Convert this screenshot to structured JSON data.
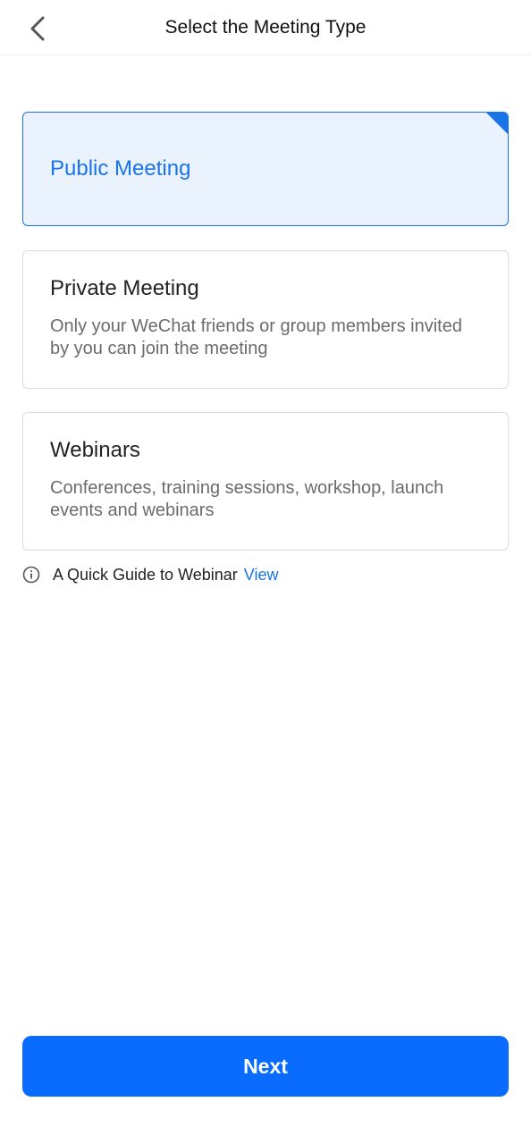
{
  "header": {
    "title": "Select the Meeting Type",
    "back_icon": "chevron-left-icon"
  },
  "options": [
    {
      "title": "Public Meeting",
      "description": "",
      "selected": true
    },
    {
      "title": "Private Meeting",
      "description": "Only your WeChat friends or group members invited by you can join the meeting",
      "selected": false
    },
    {
      "title": "Webinars",
      "description": "Conferences, training sessions, workshop, launch events and webinars",
      "selected": false
    }
  ],
  "guide": {
    "text": "A Quick Guide to Webinar",
    "link_label": "View",
    "icon": "info-icon"
  },
  "footer": {
    "next_label": "Next"
  },
  "colors": {
    "accent": "#1a73e8",
    "button": "#0a6cff",
    "selected_bg": "#e9f2fd"
  }
}
